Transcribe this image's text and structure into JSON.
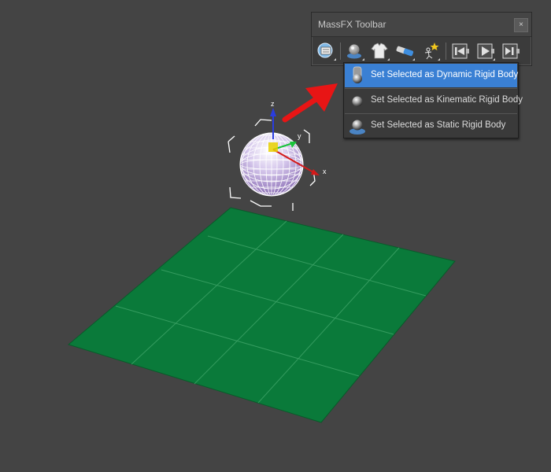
{
  "viewport": {
    "background_color": "#444444",
    "ground_color": "#0a7a3a",
    "axis_labels": {
      "z": "z",
      "y": "y",
      "x": "x"
    }
  },
  "toolbar": {
    "title": "MassFX Toolbar",
    "close_label": "×",
    "buttons": [
      {
        "name": "world-parameters-button",
        "icon": "world-params-icon"
      },
      {
        "name": "rigid-body-button",
        "icon": "rigid-body-icon"
      },
      {
        "name": "mcloth-button",
        "icon": "tshirt-icon"
      },
      {
        "name": "constraint-button",
        "icon": "constraint-icon"
      },
      {
        "name": "ragdoll-button",
        "icon": "ragdoll-icon"
      },
      {
        "name": "reset-simulation-button",
        "icon": "reset-sim-icon"
      },
      {
        "name": "start-simulation-button",
        "icon": "play-sim-icon"
      },
      {
        "name": "step-simulation-button",
        "icon": "step-sim-icon"
      }
    ]
  },
  "rigid_body_menu": {
    "items": [
      {
        "label": "Set Selected as Dynamic Rigid Body",
        "selected": true
      },
      {
        "label": "Set Selected as Kinematic Rigid Body",
        "selected": false
      },
      {
        "label": "Set Selected as Static Rigid Body",
        "selected": false
      }
    ]
  },
  "annotation": {
    "color": "#e81515"
  }
}
